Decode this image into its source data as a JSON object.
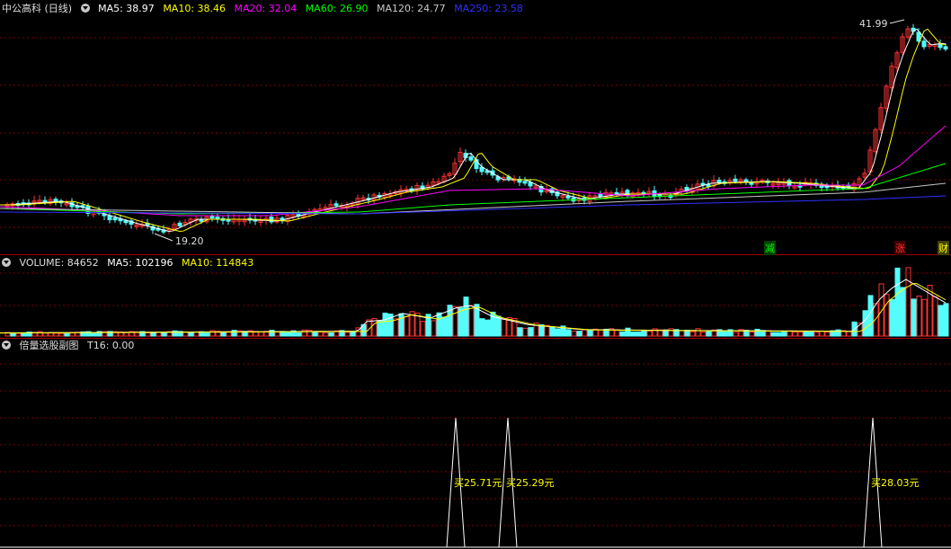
{
  "main": {
    "title": "中公高科 (日线)",
    "ma_items": [
      {
        "label": "MA5: 38.97",
        "color": "#ffffff"
      },
      {
        "label": "MA10: 38.46",
        "color": "#ffff00"
      },
      {
        "label": "MA20: 32.04",
        "color": "#ff00ff"
      },
      {
        "label": "MA60: 26.90",
        "color": "#00ff00"
      },
      {
        "label": "MA120: 24.77",
        "color": "#c8c8c8"
      },
      {
        "label": "MA250: 23.58",
        "color": "#3030ff"
      }
    ],
    "high_label": "41.99",
    "low_label": "19.20",
    "markers": [
      {
        "text": "减",
        "color": "#00ff00"
      },
      {
        "text": "涨",
        "color": "#ff3030"
      },
      {
        "text": "财",
        "color": "#ffff00"
      }
    ]
  },
  "volume": {
    "title": "VOLUME: 84652",
    "ma5": "MA5: 102196",
    "ma10": "MA10: 114843"
  },
  "indicator": {
    "title": "倍量选股副图",
    "t16": "T16: 0.00",
    "signals": [
      "买25.71元",
      "买25.29元",
      "买28.03元"
    ]
  },
  "colors": {
    "up": "#ff3232",
    "down": "#54fcfc",
    "grid": "#800000",
    "separator": "#a00000"
  }
}
